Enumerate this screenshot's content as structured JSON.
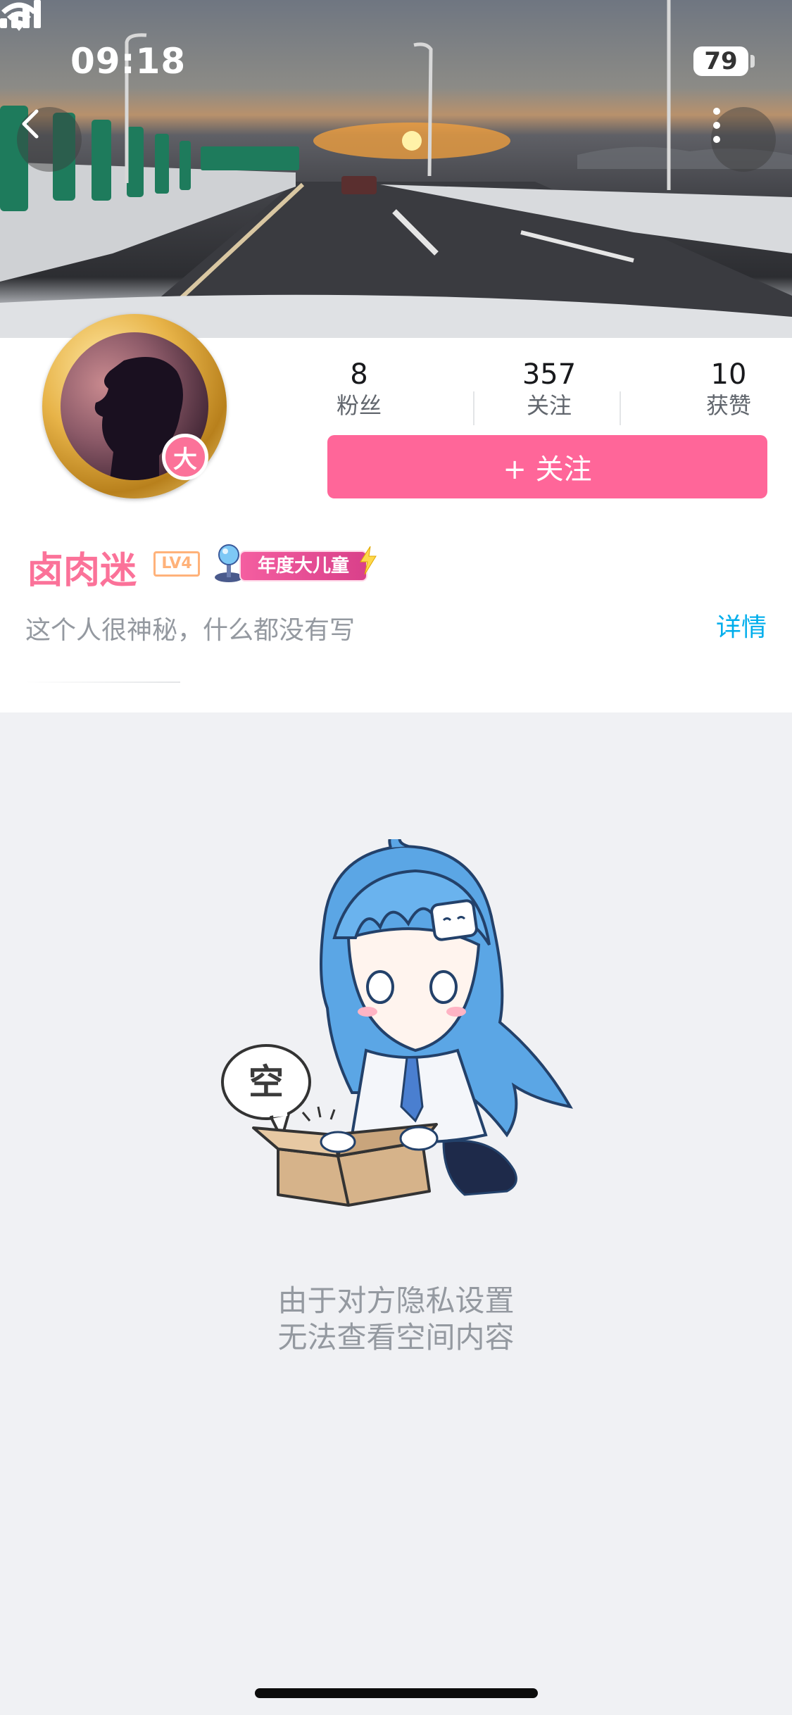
{
  "status_bar": {
    "time": "09:18",
    "battery": "79"
  },
  "profile": {
    "avatar_badge": "大",
    "stats": [
      {
        "value": "8",
        "label": "粉丝"
      },
      {
        "value": "357",
        "label": "关注"
      },
      {
        "value": "10",
        "label": "获赞"
      }
    ],
    "follow_button": "+ 关注",
    "username": "卤肉迷",
    "level": "LV4",
    "vip_label": "年度大儿童",
    "bio": "这个人很神秘，什么都没有写",
    "detail_link": "详情"
  },
  "empty_state": {
    "bubble_text": "空",
    "line1": "由于对方隐私设置",
    "line2": "无法查看空间内容"
  },
  "colors": {
    "brand_pink": "#fb7299",
    "follow_btn": "#ff6699",
    "link_blue": "#00aeec"
  },
  "icons": [
    "back-icon",
    "more-icon",
    "signal-icon",
    "wifi-icon",
    "battery-icon"
  ]
}
